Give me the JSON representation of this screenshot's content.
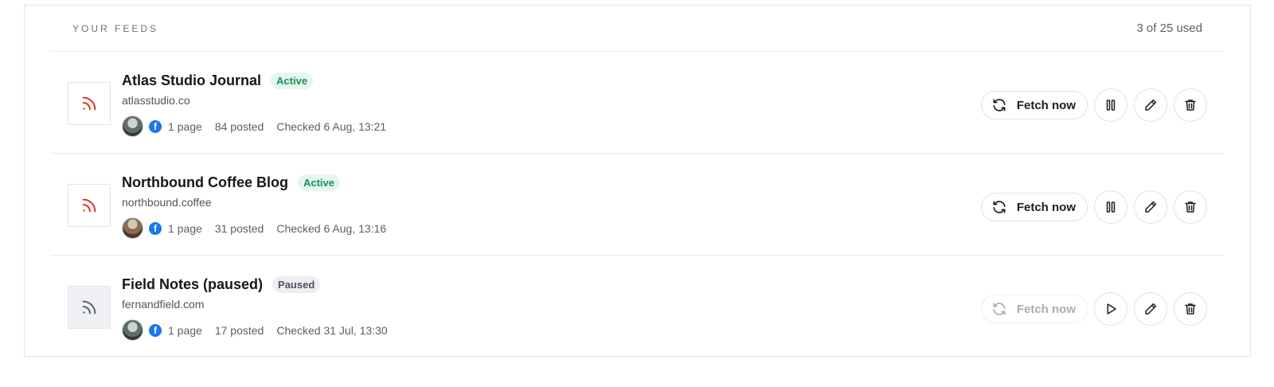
{
  "header": {
    "section_title": "YOUR FEEDS",
    "usage": "3 of 25 used"
  },
  "colors": {
    "rss_active": "#e0322b",
    "rss_paused": "#5c6370",
    "badge_active": "#12955a",
    "facebook": "#1877f2"
  },
  "feeds": [
    {
      "title": "Atlas Studio Journal",
      "status": "Active",
      "domain": "atlasstudio.co",
      "pages": "1 page",
      "posted": "84 posted",
      "checked": "Checked 6 Aug, 13:21",
      "fetch_label": "Fetch now",
      "toggle_icon": "pause-icon"
    },
    {
      "title": "Northbound Coffee Blog",
      "status": "Active",
      "domain": "northbound.coffee",
      "pages": "1 page",
      "posted": "31 posted",
      "checked": "Checked 6 Aug, 13:16",
      "fetch_label": "Fetch now",
      "toggle_icon": "pause-icon"
    },
    {
      "title": "Field Notes (paused)",
      "status": "Paused",
      "domain": "fernandfield.com",
      "pages": "1 page",
      "posted": "17 posted",
      "checked": "Checked 31 Jul, 13:30",
      "fetch_label": "Fetch now",
      "toggle_icon": "play-icon"
    }
  ]
}
